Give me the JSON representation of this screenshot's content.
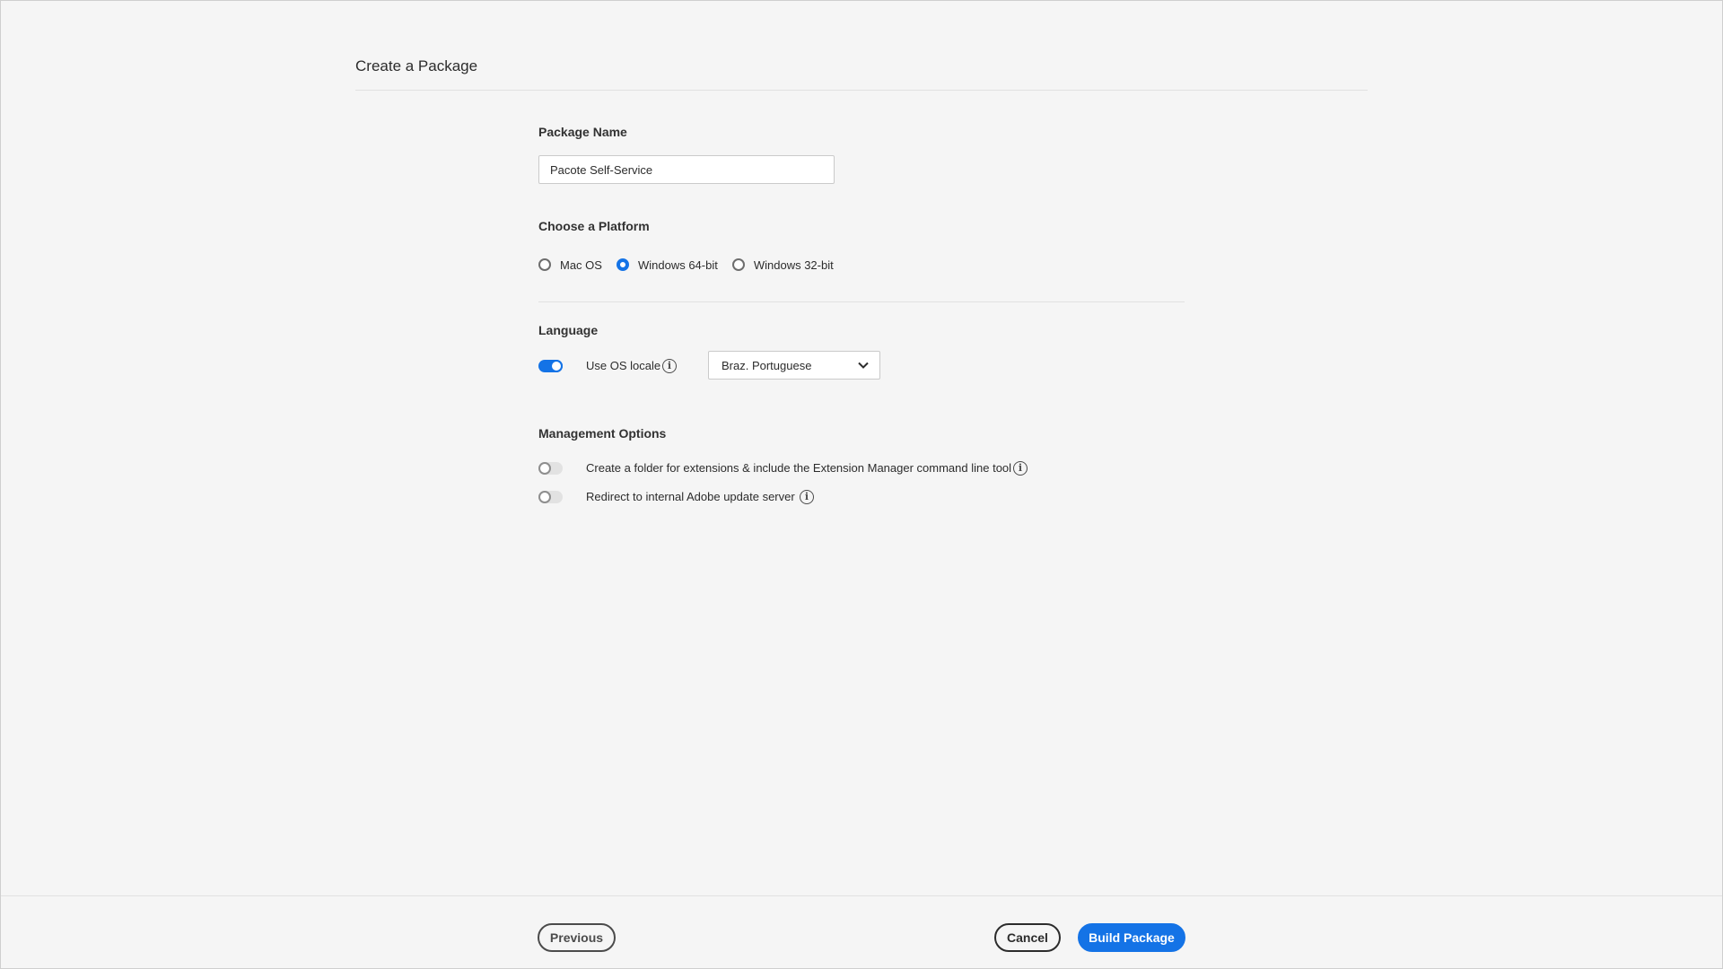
{
  "page": {
    "title": "Create a Package"
  },
  "package_name": {
    "label": "Package Name",
    "value": "Pacote Self-Service"
  },
  "platform": {
    "label": "Choose a Platform",
    "options": [
      {
        "label": "Mac OS",
        "selected": false
      },
      {
        "label": "Windows 64-bit",
        "selected": true
      },
      {
        "label": "Windows 32-bit",
        "selected": false
      }
    ]
  },
  "language": {
    "label": "Language",
    "use_os_locale_label": "Use OS locale",
    "use_os_locale_on": true,
    "selected_language": "Braz. Portuguese",
    "info_icon": "info-icon"
  },
  "management": {
    "label": "Management Options",
    "options": [
      {
        "label": "Create a folder for extensions & include the Extension Manager command line tool",
        "enabled": false
      },
      {
        "label": "Redirect to internal Adobe update server",
        "enabled": false
      }
    ]
  },
  "footer": {
    "previous_label": "Previous",
    "cancel_label": "Cancel",
    "build_label": "Build Package"
  },
  "colors": {
    "accent": "#1473e6",
    "background": "#f5f5f5"
  }
}
